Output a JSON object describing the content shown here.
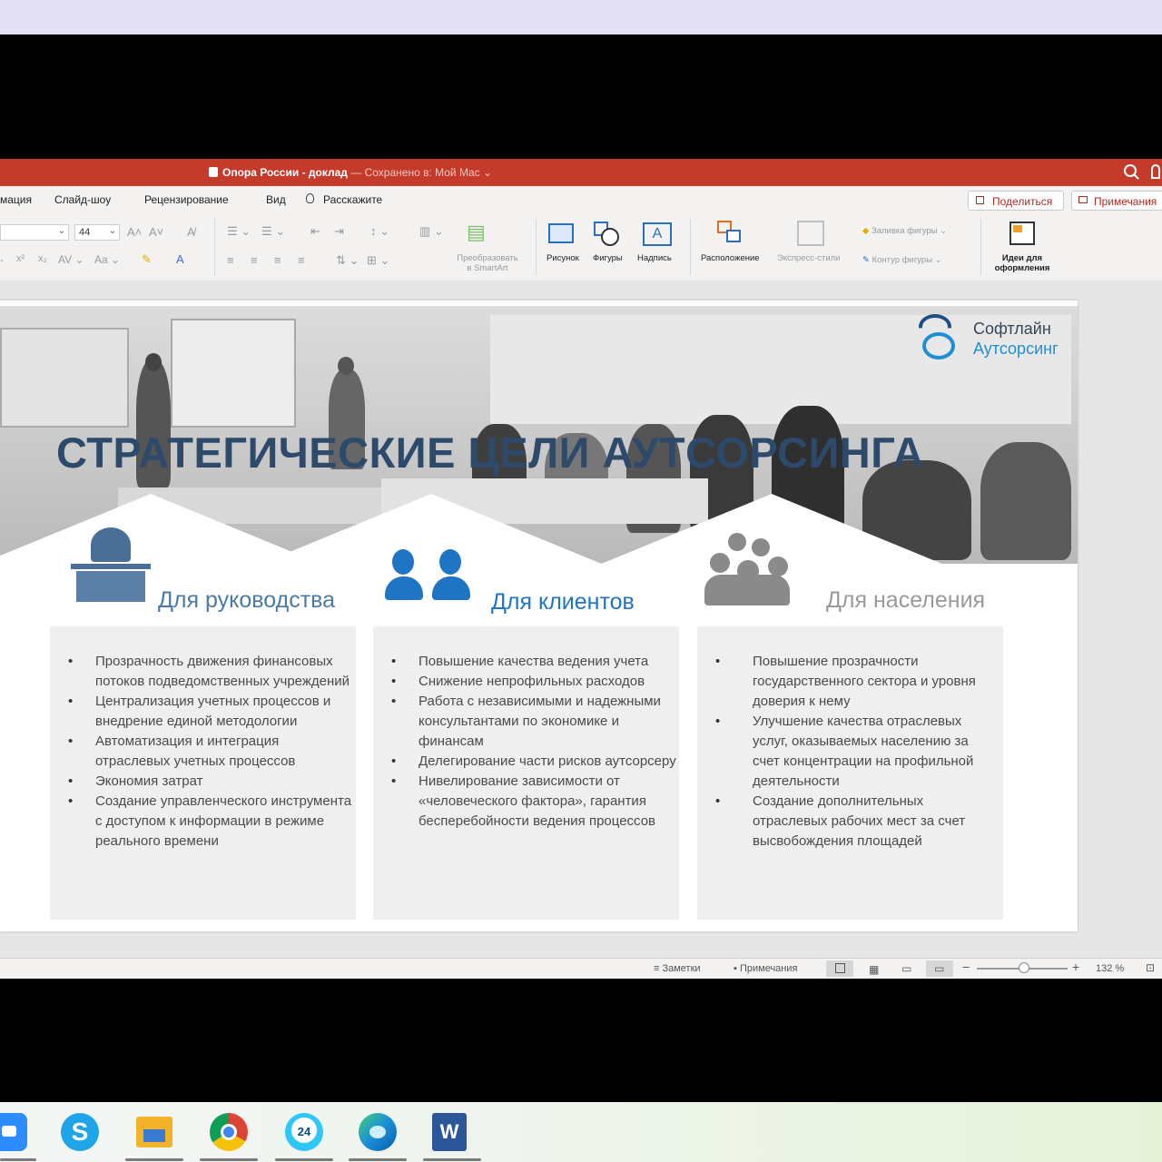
{
  "window": {
    "title": "Опора России - доклад",
    "saved_status": "— Сохранено в: Мой Mac"
  },
  "menu": {
    "items": [
      "мация",
      "Слайд-шоу",
      "Рецензирование",
      "Вид",
      "Расскажите"
    ],
    "share_label": "Поделиться",
    "comments_label": "Примечания"
  },
  "ribbon": {
    "font_size": "44",
    "smartart_label_1": "Преобразовать",
    "smartart_label_2": "в SmartArt",
    "picture_label": "Рисунок",
    "shapes_label": "Фигуры",
    "textbox_label": "Надпись",
    "arrange_label": "Расположение",
    "quickstyles_label": "Экспресс-стили",
    "shape_fill_label": "Заливка фигуры",
    "shape_outline_label": "Контур фигуры",
    "ideas_label_1": "Идеи для",
    "ideas_label_2": "оформления"
  },
  "slide": {
    "title": "СТРАТЕГИЧЕСКИЕ ЦЕЛИ АУТСОРСИНГА",
    "logo_line1": "Софтлайн",
    "logo_line2": "Аутсорсинг",
    "columns": [
      {
        "heading": "Для руководства",
        "items": [
          "Прозрачность движения финансовых потоков подведомственных учреждений",
          "Централизация учетных процессов и внедрение единой методологии",
          "Автоматизация и интеграция отраслевых учетных процессов",
          "Экономия затрат",
          "Создание управленческого инструмента с доступом к информации в режиме реального времени"
        ]
      },
      {
        "heading": "Для клиентов",
        "items": [
          "Повышение качества ведения учета",
          "Снижение непрофильных расходов",
          "Работа с независимыми и надежными консультантами по экономике и финансам",
          "Делегирование части рисков аутсорсеру",
          "Нивелирование зависимости от «человеческого фактора», гарантия бесперебойности ведения процессов"
        ]
      },
      {
        "heading": "Для населения",
        "items": [
          "Повышение прозрачности государственного сектора и уровня доверия к нему",
          "Улучшение качества отраслевых услуг, оказываемых населению за счет концентрации на профильной деятельности",
          "Создание дополнительных отраслевых рабочих мест за счет высвобождения площадей"
        ]
      }
    ]
  },
  "statusbar": {
    "notes_label": "Заметки",
    "comments_label": "Примечания",
    "zoom": "132 %"
  },
  "taskbar": {
    "apps": [
      "zoom-icon",
      "skype-icon",
      "file-explorer-icon",
      "chrome-icon",
      "bitrix24-icon",
      "edge-icon",
      "word-icon"
    ]
  },
  "colors": {
    "titlebar": "#c43b2b",
    "slide_title": "#2d4a6b",
    "col1_heading": "#4a7aa8",
    "col2_heading": "#1f74c4",
    "col3_heading": "#9a9a9a"
  }
}
